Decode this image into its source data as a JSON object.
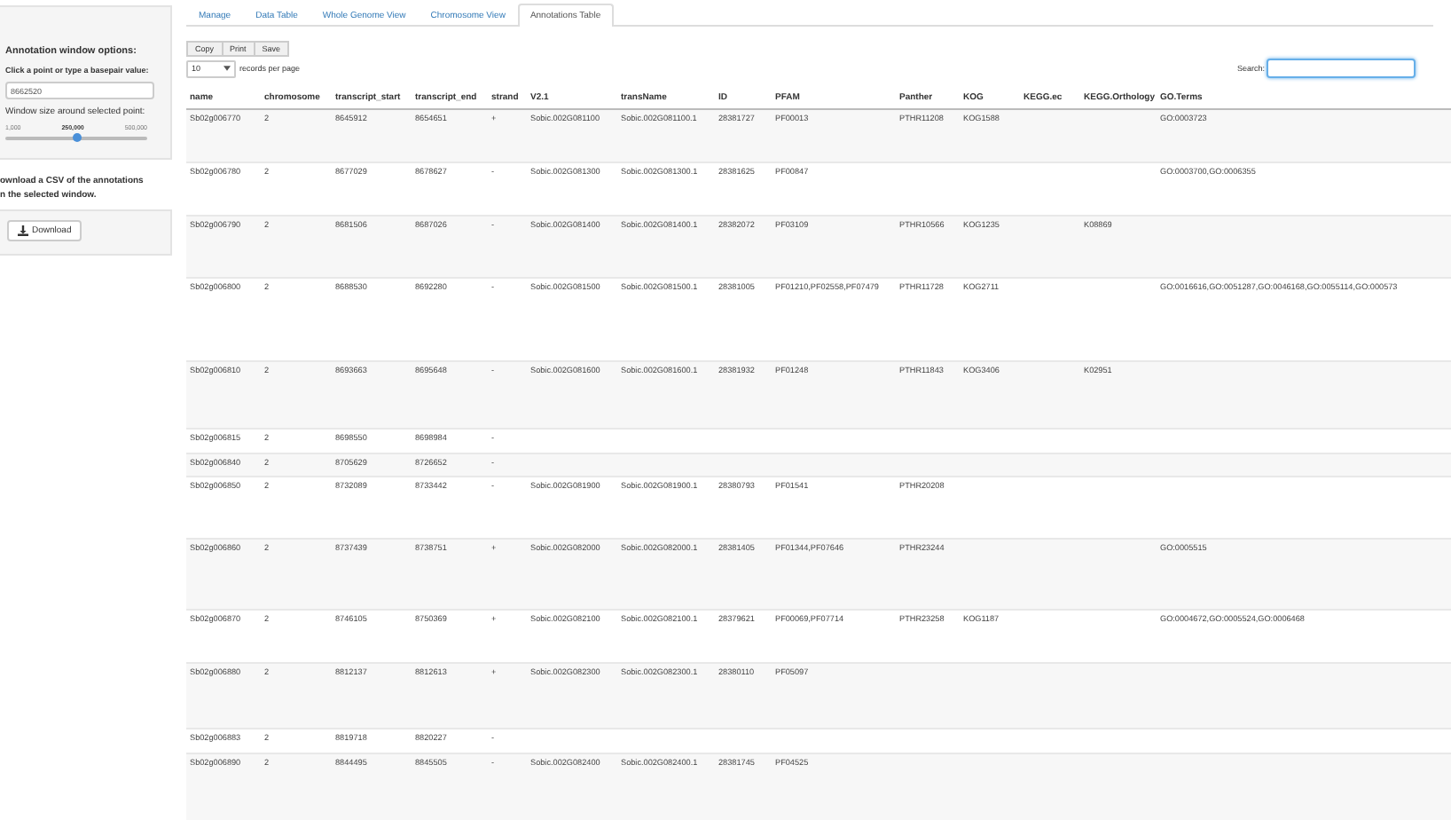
{
  "sidebar": {
    "title": "Annotation window options:",
    "point_label": "Click a point or type a basepair value:",
    "point_value": "8662520",
    "window_label": "Window size around selected point:",
    "slider": {
      "min": "1,000",
      "value": "250,000",
      "max": "500,000",
      "level": 0.5
    },
    "download_text": "ownload a CSV of the annotations\nn the selected window.",
    "download_button": "Download"
  },
  "tabs": [
    {
      "label": "Manage",
      "selected": false
    },
    {
      "label": "Data Table",
      "selected": false
    },
    {
      "label": "Whole Genome View",
      "selected": false
    },
    {
      "label": "Chromosome View",
      "selected": false
    },
    {
      "label": "Annotations Table",
      "selected": true
    }
  ],
  "table_buttons": [
    "Copy",
    "Print",
    "Save"
  ],
  "page_length": {
    "value": "10",
    "label": "records per page"
  },
  "search": {
    "label": "Search:"
  },
  "table": {
    "columns": [
      "name",
      "chromosome",
      "transcript_start",
      "transcript_end",
      "strand",
      "V2.1",
      "transName",
      "ID",
      "PFAM",
      "Panther",
      "KOG",
      "KEGG.ec",
      "KEGG.Orthology",
      "GO.Terms"
    ],
    "rows": [
      [
        "Sb02g006770",
        "2",
        "8645912",
        "8654651",
        "+",
        "Sobic.002G081100",
        "Sobic.002G081100.1",
        "28381727",
        "PF00013",
        "PTHR11208",
        "KOG1588",
        null,
        null,
        "GO:0003723"
      ],
      [
        "Sb02g006780",
        "2",
        "8677029",
        "8678627",
        "-",
        "Sobic.002G081300",
        "Sobic.002G081300.1",
        "28381625",
        "PF00847",
        null,
        null,
        null,
        null,
        "GO:0003700,GO:0006355"
      ],
      [
        "Sb02g006790",
        "2",
        "8681506",
        "8687026",
        "-",
        "Sobic.002G081400",
        "Sobic.002G081400.1",
        "28382072",
        "PF03109",
        "PTHR10566",
        "KOG1235",
        null,
        "K08869",
        null
      ],
      [
        "Sb02g006800",
        "2",
        "8688530",
        "8692280",
        "-",
        "Sobic.002G081500",
        "Sobic.002G081500.1",
        "28381005",
        "PF01210,PF02558,PF07479",
        "PTHR11728",
        "KOG2711",
        null,
        null,
        "GO:0016616,GO:0051287,GO:0046168,GO:0055114,GO:000573"
      ],
      [
        "Sb02g006810",
        "2",
        "8693663",
        "8695648",
        "-",
        "Sobic.002G081600",
        "Sobic.002G081600.1",
        "28381932",
        "PF01248",
        "PTHR11843",
        "KOG3406",
        null,
        "K02951",
        null
      ],
      [
        "Sb02g006815",
        "2",
        "8698550",
        "8698984",
        "-",
        null,
        null,
        null,
        null,
        null,
        null,
        null,
        null,
        null
      ],
      [
        "Sb02g006840",
        "2",
        "8705629",
        "8726652",
        "-",
        null,
        null,
        null,
        null,
        null,
        null,
        null,
        null,
        null
      ],
      [
        "Sb02g006850",
        "2",
        "8732089",
        "8733442",
        "-",
        "Sobic.002G081900",
        "Sobic.002G081900.1",
        "28380793",
        "PF01541",
        "PTHR20208",
        null,
        null,
        null,
        null
      ],
      [
        "Sb02g006860",
        "2",
        "8737439",
        "8738751",
        "+",
        "Sobic.002G082000",
        "Sobic.002G082000.1",
        "28381405",
        "PF01344,PF07646",
        "PTHR23244",
        null,
        null,
        null,
        "GO:0005515"
      ],
      [
        "Sb02g006870",
        "2",
        "8746105",
        "8750369",
        "+",
        "Sobic.002G082100",
        "Sobic.002G082100.1",
        "28379621",
        "PF00069,PF07714",
        "PTHR23258",
        "KOG1187",
        null,
        null,
        "GO:0004672,GO:0005524,GO:0006468"
      ],
      [
        "Sb02g006880",
        "2",
        "8812137",
        "8812613",
        "+",
        "Sobic.002G082300",
        "Sobic.002G082300.1",
        "28380110",
        "PF05097",
        null,
        null,
        null,
        null,
        null
      ],
      [
        "Sb02g006883",
        "2",
        "8819718",
        "8820227",
        "-",
        null,
        null,
        null,
        null,
        null,
        null,
        null,
        null,
        null
      ],
      [
        "Sb02g006890",
        "2",
        "8844495",
        "8845505",
        "-",
        "Sobic.002G082400",
        "Sobic.002G082400.1",
        "28381745",
        "PF04525",
        null,
        null,
        null,
        null,
        null
      ]
    ]
  }
}
